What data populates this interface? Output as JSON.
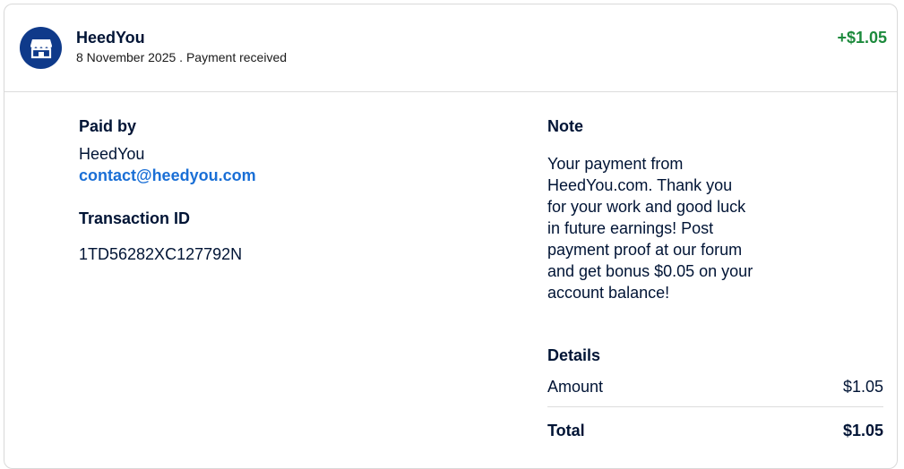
{
  "header": {
    "merchant_name": "HeedYou",
    "subtitle": "8 November 2025 . Payment received",
    "amount": "+$1.05",
    "avatar_icon": "store-icon",
    "amount_color": "#1c8a3c",
    "avatar_color": "#0f3a8a"
  },
  "paid_by": {
    "label": "Paid by",
    "name": "HeedYou",
    "email": "contact@heedyou.com"
  },
  "transaction": {
    "label": "Transaction ID",
    "id": "1TD56282XC127792N"
  },
  "note": {
    "label": "Note",
    "body": "Your payment from HeedYou.com. Thank you for your work and good luck in future earnings! Post payment proof at our forum and get bonus $0.05 on your account balance!"
  },
  "details": {
    "label": "Details",
    "amount_label": "Amount",
    "amount_value": "$1.05",
    "total_label": "Total",
    "total_value": "$1.05"
  }
}
